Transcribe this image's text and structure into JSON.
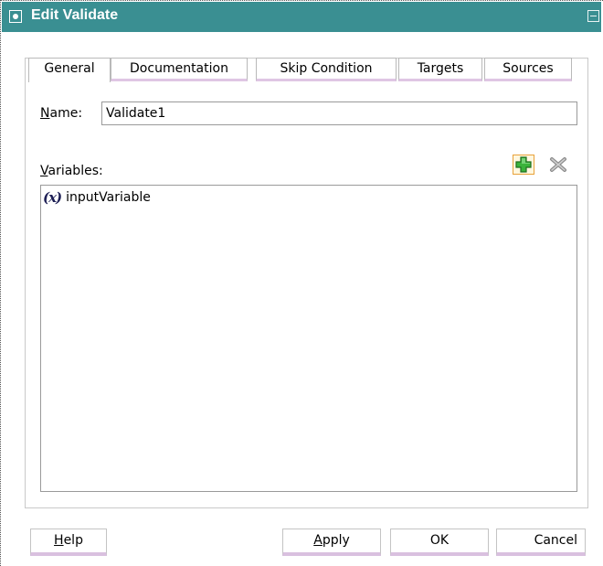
{
  "window": {
    "title": "Edit Validate"
  },
  "tabs": [
    {
      "label": "General",
      "active": true
    },
    {
      "label": "Documentation",
      "active": false
    },
    {
      "label": "Skip Condition",
      "active": false
    },
    {
      "label": "Targets",
      "active": false
    },
    {
      "label": "Sources",
      "active": false
    }
  ],
  "general": {
    "name_label_mnemonic": "N",
    "name_label_rest": "ame:",
    "name_value": "Validate1",
    "variables_label_mnemonic": "V",
    "variables_label_rest": "ariables:",
    "variables": [
      {
        "icon": "(x)",
        "label": "inputVariable"
      }
    ],
    "add_icon": "plus-icon",
    "remove_icon": "x-icon"
  },
  "buttons": {
    "help_mnemonic": "H",
    "help_rest": "elp",
    "apply_mnemonic": "A",
    "apply_rest": "pply",
    "ok": "OK",
    "cancel": "Cancel"
  },
  "colors": {
    "title_bar": "#3a8f92",
    "tab_underline": "#dfc6e4",
    "add_button_border": "#e8a23a"
  }
}
